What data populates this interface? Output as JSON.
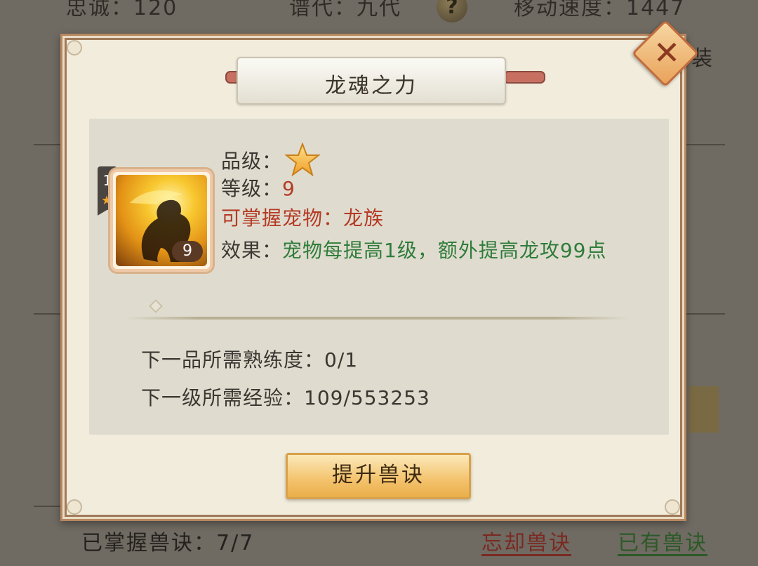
{
  "background": {
    "stats": [
      {
        "label": "忠诚：120"
      },
      {
        "label": "谱代：九代"
      },
      {
        "label": "移动速度：1447"
      }
    ],
    "help_icon": "?",
    "side_peek_text": "装",
    "bottom": {
      "learned_text": "已掌握兽诀：7/7",
      "forget_link": "忘却兽诀",
      "owned_link": "已有兽诀"
    }
  },
  "dialog": {
    "title": "龙魂之力",
    "close_icon": "close-x",
    "item": {
      "level_badge": "9",
      "grade_num": "1",
      "grade_star": "★"
    },
    "attributes": {
      "grade_label": "品级：",
      "grade_stars": 1,
      "level_label": "等级：",
      "level_value": "9",
      "pet_line": "可掌握宠物：龙族",
      "effect_label": "效果：",
      "effect_value": "宠物每提高1级，额外提高龙攻99点"
    },
    "requirements": {
      "next_grade": "下一品所需熟练度：0/1",
      "next_level": "下一级所需经验：109/553253"
    },
    "upgrade_button": "提升兽诀"
  },
  "colors": {
    "dialog_bg": "#f1ecdc",
    "panel_bg": "#dfdccf",
    "accent_red": "#b43a24",
    "accent_green": "#2f7c3a",
    "button_gold": "#f3c26c"
  }
}
